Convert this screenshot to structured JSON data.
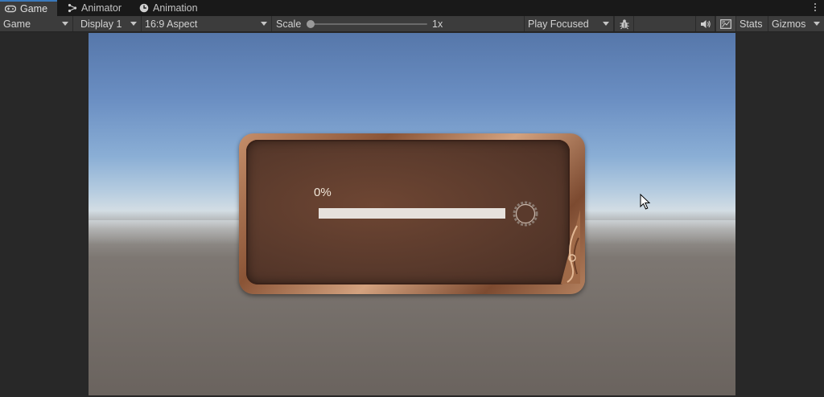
{
  "tabs": [
    {
      "label": "Game",
      "icon": "gamepad-icon",
      "active": true
    },
    {
      "label": "Animator",
      "icon": "animator-icon",
      "active": false
    },
    {
      "label": "Animation",
      "icon": "clock-icon",
      "active": false
    }
  ],
  "toolbar": {
    "view_mode": "Game",
    "display": "Display 1",
    "aspect": "16:9 Aspect",
    "scale_label": "Scale",
    "scale_value": "1x",
    "play_mode": "Play Focused",
    "stats_label": "Stats",
    "gizmos_label": "Gizmos"
  },
  "game": {
    "progress_text": "0%",
    "progress_fraction": 0.0,
    "fill_color": "#e6e1dc"
  },
  "colors": {
    "accent": "#3a79bb",
    "toolbar_bg": "#3c3c3c",
    "tabbar_bg": "#191919"
  }
}
